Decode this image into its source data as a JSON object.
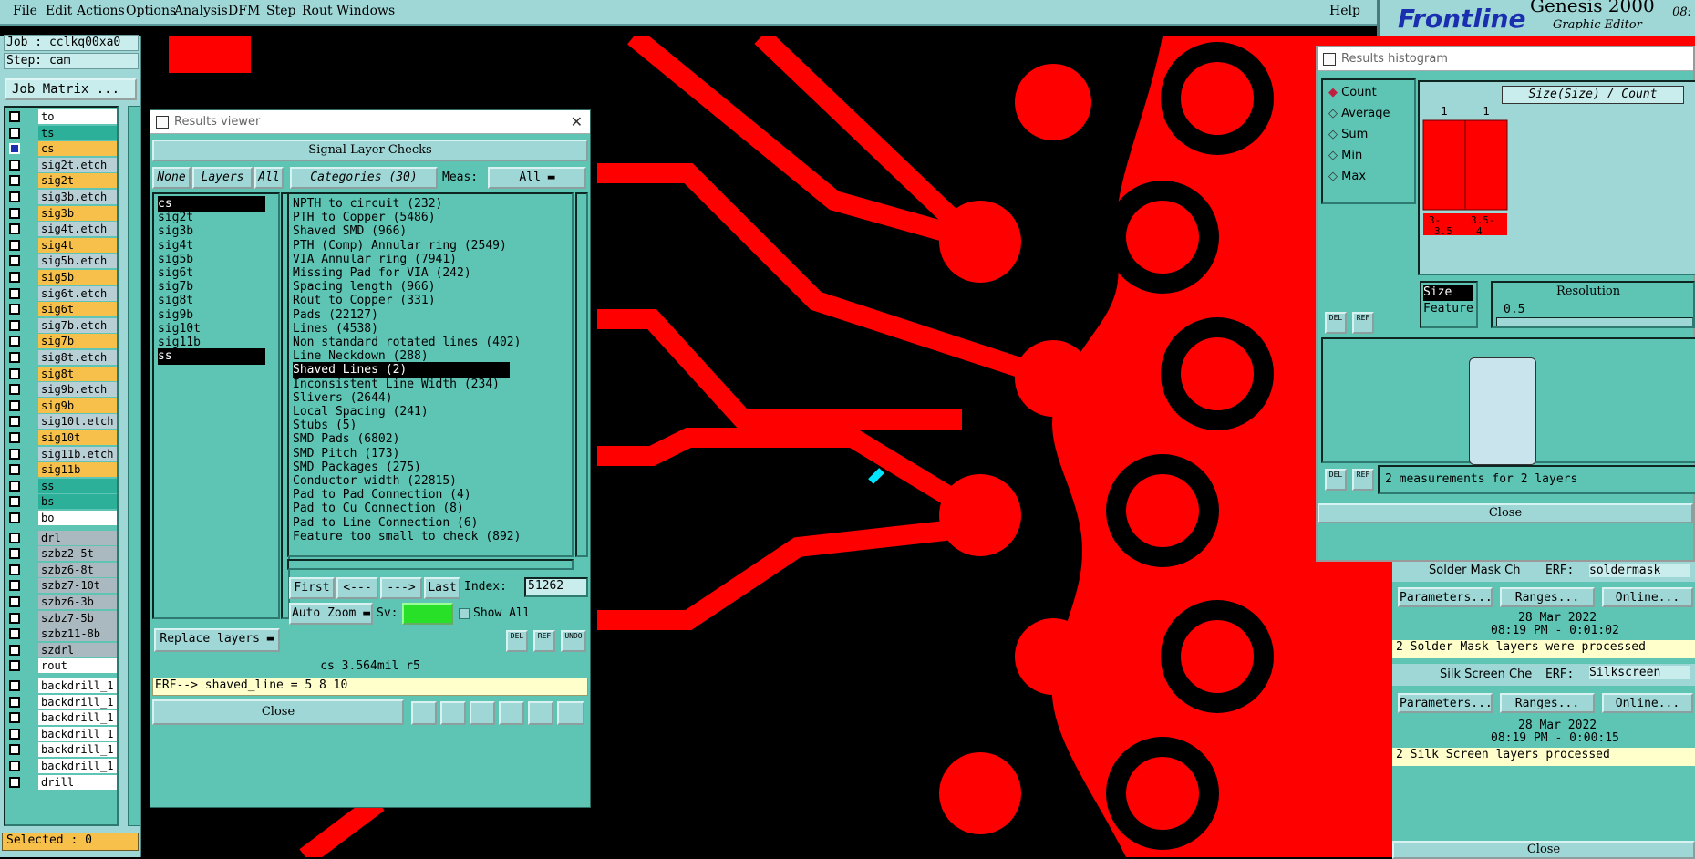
{
  "menubar": {
    "items": [
      "File",
      "Edit",
      "Actions",
      "Options",
      "Analysis",
      "DFM",
      "Step",
      "Rout",
      "Windows"
    ],
    "help": "Help"
  },
  "brand": {
    "logo": "Frontline",
    "product": "Genesis 2000",
    "subtitle": "Graphic Editor",
    "time": "08:"
  },
  "left_panel": {
    "job": "Job : cclkq00xa0",
    "step": "Step: cam",
    "job_matrix": "Job Matrix ...",
    "layers": [
      {
        "name": "to",
        "color": "#ffffff"
      },
      {
        "name": "ts",
        "color": "#2db09a"
      },
      {
        "name": "cs",
        "color": "#f7c04a",
        "selected": true
      },
      {
        "name": "sig2t.etch",
        "color": "#b9cfd6"
      },
      {
        "name": "sig2t",
        "color": "#f7c04a"
      },
      {
        "name": "sig3b.etch",
        "color": "#b9cfd6"
      },
      {
        "name": "sig3b",
        "color": "#f7c04a"
      },
      {
        "name": "sig4t.etch",
        "color": "#b9cfd6"
      },
      {
        "name": "sig4t",
        "color": "#f7c04a"
      },
      {
        "name": "sig5b.etch",
        "color": "#b9cfd6"
      },
      {
        "name": "sig5b",
        "color": "#f7c04a"
      },
      {
        "name": "sig6t.etch",
        "color": "#b9cfd6"
      },
      {
        "name": "sig6t",
        "color": "#f7c04a"
      },
      {
        "name": "sig7b.etch",
        "color": "#b9cfd6"
      },
      {
        "name": "sig7b",
        "color": "#f7c04a"
      },
      {
        "name": "sig8t.etch",
        "color": "#b9cfd6"
      },
      {
        "name": "sig8t",
        "color": "#f7c04a"
      },
      {
        "name": "sig9b.etch",
        "color": "#b9cfd6"
      },
      {
        "name": "sig9b",
        "color": "#f7c04a"
      },
      {
        "name": "sig10t.etch",
        "color": "#b9cfd6"
      },
      {
        "name": "sig10t",
        "color": "#f7c04a"
      },
      {
        "name": "sig11b.etch",
        "color": "#b9cfd6"
      },
      {
        "name": "sig11b",
        "color": "#f7c04a"
      },
      {
        "name": "ss",
        "color": "#2db09a"
      },
      {
        "name": "bs",
        "color": "#2db09a"
      },
      {
        "name": "bo",
        "color": "#ffffff"
      },
      {
        "name": "drl",
        "color": "#a9b9bf"
      },
      {
        "name": "szbz2-5t",
        "color": "#a9b9bf"
      },
      {
        "name": "szbz6-8t",
        "color": "#a9b9bf"
      },
      {
        "name": "szbz7-10t",
        "color": "#a9b9bf"
      },
      {
        "name": "szbz6-3b",
        "color": "#a9b9bf"
      },
      {
        "name": "szbz7-5b",
        "color": "#a9b9bf"
      },
      {
        "name": "szbz11-8b",
        "color": "#a9b9bf"
      },
      {
        "name": "szdrl",
        "color": "#a9b9bf"
      },
      {
        "name": "rout",
        "color": "#ffffff"
      },
      {
        "name": "backdrill_1",
        "color": "#ffffff"
      },
      {
        "name": "backdrill_1",
        "color": "#ffffff"
      },
      {
        "name": "backdrill_1",
        "color": "#ffffff"
      },
      {
        "name": "backdrill_1",
        "color": "#ffffff"
      },
      {
        "name": "backdrill_1",
        "color": "#ffffff"
      },
      {
        "name": "backdrill_1",
        "color": "#ffffff"
      },
      {
        "name": "drill",
        "color": "#ffffff"
      }
    ],
    "selected": "Selected : 0"
  },
  "results_viewer": {
    "title": "Results viewer",
    "header": "Signal Layer Checks",
    "none_btn": "None",
    "layers_btn": "Layers",
    "all_btn": "All",
    "categories_btn": "Categories (30)",
    "meas_label": "Meas:",
    "meas_value": "All",
    "layers": [
      "cs",
      "sig2t",
      "sig3b",
      "sig4t",
      "sig5b",
      "sig6t",
      "sig7b",
      "sig8t",
      "sig9b",
      "sig10t",
      "sig11b",
      "ss"
    ],
    "categories": [
      "NPTH to circuit (232)",
      "PTH to Copper (5486)",
      "Shaved SMD (966)",
      "PTH (Comp) Annular ring (2549)",
      "VIA Annular ring (7941)",
      "Missing Pad for VIA (242)",
      "Spacing length (966)",
      "Rout to Copper (331)",
      "Pads (22127)",
      "Lines (4538)",
      "Non standard rotated lines (402)",
      "Line Neckdown (288)",
      "Shaved Lines (2)",
      "Inconsistent Line Width (234)",
      "Slivers (2644)",
      "Local Spacing (241)",
      "Stubs (5)",
      "SMD Pads (6802)",
      "SMD Pitch (173)",
      "SMD Packages (275)",
      "Conductor width (22815)",
      "Pad to Pad Connection (4)",
      "Pad to Cu Connection (8)",
      "Pad to Line Connection (6)",
      "Feature too small to check (892)"
    ],
    "selected_category_index": 12,
    "first_btn": "First",
    "prev_btn": "<---",
    "next_btn": "--->",
    "last_btn": "Last",
    "index_label": "Index:",
    "index_value": "51262",
    "auto_zoom": "Auto Zoom",
    "sv_label": "Sv:",
    "show_all": "Show All",
    "replace_layers": "Replace layers",
    "del_btn": "DEL",
    "ref_btn": "REF",
    "undo_btn": "UNDO",
    "status": "cs 3.564mil  r5",
    "erf_line": "ERF--> shaved_line = 5 8 10",
    "close": "Close"
  },
  "histogram": {
    "title": "Results histogram",
    "options": [
      "Count",
      "Average",
      "Sum",
      "Min",
      "Max"
    ],
    "selected_option": "Count",
    "chart_title": "Size(Size) / Count",
    "del_btn": "DEL",
    "ref_btn": "REF",
    "fields": [
      "Size",
      "Feature"
    ],
    "resolution_label": "Resolution",
    "resolution_value": "0.5",
    "measurements": "2 measurements for 2 layers",
    "close": "Close"
  },
  "chart_data": {
    "type": "bar",
    "title": "Size(Size) / Count",
    "categories": [
      "3-3.5",
      "3.5-4"
    ],
    "tick_labels": [
      "3-\n3.5",
      "3.5-\n4"
    ],
    "values": [
      1,
      1
    ],
    "bar_color": "#ff0000"
  },
  "process_panel": {
    "solder_label": "Solder Mask Ch",
    "erf1": "ERF:",
    "erf1_value": "soldermask",
    "params": "Parameters...",
    "ranges": "Ranges...",
    "online": "Online...",
    "date1": "28 Mar 2022",
    "time1": "08:19 PM - 0:01:02",
    "msg1": "2 Solder Mask layers were processed",
    "silk_label": "Silk Screen Che",
    "erf2": "ERF:",
    "erf2_value": "Silkscreen",
    "date2": "28 Mar 2022",
    "time2": "08:19 PM - 0:00:15",
    "msg2": "2 Silk Screen layers processed",
    "close": "Close"
  },
  "colors": {
    "panel": "#9fd6d6",
    "dialog": "#5ec4b4",
    "copper": "#ff0000",
    "highlight": "#00e5ff"
  }
}
